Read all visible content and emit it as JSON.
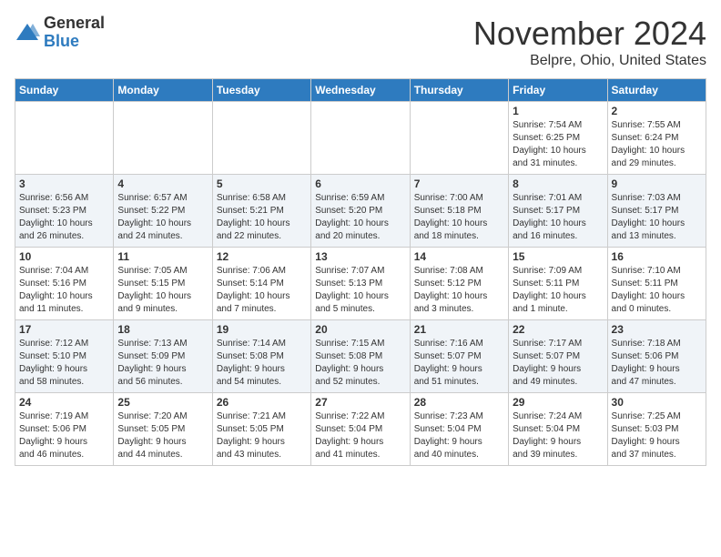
{
  "header": {
    "logo_general": "General",
    "logo_blue": "Blue",
    "month": "November 2024",
    "location": "Belpre, Ohio, United States"
  },
  "weekdays": [
    "Sunday",
    "Monday",
    "Tuesday",
    "Wednesday",
    "Thursday",
    "Friday",
    "Saturday"
  ],
  "weeks": [
    [
      {
        "day": "",
        "info": ""
      },
      {
        "day": "",
        "info": ""
      },
      {
        "day": "",
        "info": ""
      },
      {
        "day": "",
        "info": ""
      },
      {
        "day": "",
        "info": ""
      },
      {
        "day": "1",
        "info": "Sunrise: 7:54 AM\nSunset: 6:25 PM\nDaylight: 10 hours\nand 31 minutes."
      },
      {
        "day": "2",
        "info": "Sunrise: 7:55 AM\nSunset: 6:24 PM\nDaylight: 10 hours\nand 29 minutes."
      }
    ],
    [
      {
        "day": "3",
        "info": "Sunrise: 6:56 AM\nSunset: 5:23 PM\nDaylight: 10 hours\nand 26 minutes."
      },
      {
        "day": "4",
        "info": "Sunrise: 6:57 AM\nSunset: 5:22 PM\nDaylight: 10 hours\nand 24 minutes."
      },
      {
        "day": "5",
        "info": "Sunrise: 6:58 AM\nSunset: 5:21 PM\nDaylight: 10 hours\nand 22 minutes."
      },
      {
        "day": "6",
        "info": "Sunrise: 6:59 AM\nSunset: 5:20 PM\nDaylight: 10 hours\nand 20 minutes."
      },
      {
        "day": "7",
        "info": "Sunrise: 7:00 AM\nSunset: 5:18 PM\nDaylight: 10 hours\nand 18 minutes."
      },
      {
        "day": "8",
        "info": "Sunrise: 7:01 AM\nSunset: 5:17 PM\nDaylight: 10 hours\nand 16 minutes."
      },
      {
        "day": "9",
        "info": "Sunrise: 7:03 AM\nSunset: 5:17 PM\nDaylight: 10 hours\nand 13 minutes."
      }
    ],
    [
      {
        "day": "10",
        "info": "Sunrise: 7:04 AM\nSunset: 5:16 PM\nDaylight: 10 hours\nand 11 minutes."
      },
      {
        "day": "11",
        "info": "Sunrise: 7:05 AM\nSunset: 5:15 PM\nDaylight: 10 hours\nand 9 minutes."
      },
      {
        "day": "12",
        "info": "Sunrise: 7:06 AM\nSunset: 5:14 PM\nDaylight: 10 hours\nand 7 minutes."
      },
      {
        "day": "13",
        "info": "Sunrise: 7:07 AM\nSunset: 5:13 PM\nDaylight: 10 hours\nand 5 minutes."
      },
      {
        "day": "14",
        "info": "Sunrise: 7:08 AM\nSunset: 5:12 PM\nDaylight: 10 hours\nand 3 minutes."
      },
      {
        "day": "15",
        "info": "Sunrise: 7:09 AM\nSunset: 5:11 PM\nDaylight: 10 hours\nand 1 minute."
      },
      {
        "day": "16",
        "info": "Sunrise: 7:10 AM\nSunset: 5:11 PM\nDaylight: 10 hours\nand 0 minutes."
      }
    ],
    [
      {
        "day": "17",
        "info": "Sunrise: 7:12 AM\nSunset: 5:10 PM\nDaylight: 9 hours\nand 58 minutes."
      },
      {
        "day": "18",
        "info": "Sunrise: 7:13 AM\nSunset: 5:09 PM\nDaylight: 9 hours\nand 56 minutes."
      },
      {
        "day": "19",
        "info": "Sunrise: 7:14 AM\nSunset: 5:08 PM\nDaylight: 9 hours\nand 54 minutes."
      },
      {
        "day": "20",
        "info": "Sunrise: 7:15 AM\nSunset: 5:08 PM\nDaylight: 9 hours\nand 52 minutes."
      },
      {
        "day": "21",
        "info": "Sunrise: 7:16 AM\nSunset: 5:07 PM\nDaylight: 9 hours\nand 51 minutes."
      },
      {
        "day": "22",
        "info": "Sunrise: 7:17 AM\nSunset: 5:07 PM\nDaylight: 9 hours\nand 49 minutes."
      },
      {
        "day": "23",
        "info": "Sunrise: 7:18 AM\nSunset: 5:06 PM\nDaylight: 9 hours\nand 47 minutes."
      }
    ],
    [
      {
        "day": "24",
        "info": "Sunrise: 7:19 AM\nSunset: 5:06 PM\nDaylight: 9 hours\nand 46 minutes."
      },
      {
        "day": "25",
        "info": "Sunrise: 7:20 AM\nSunset: 5:05 PM\nDaylight: 9 hours\nand 44 minutes."
      },
      {
        "day": "26",
        "info": "Sunrise: 7:21 AM\nSunset: 5:05 PM\nDaylight: 9 hours\nand 43 minutes."
      },
      {
        "day": "27",
        "info": "Sunrise: 7:22 AM\nSunset: 5:04 PM\nDaylight: 9 hours\nand 41 minutes."
      },
      {
        "day": "28",
        "info": "Sunrise: 7:23 AM\nSunset: 5:04 PM\nDaylight: 9 hours\nand 40 minutes."
      },
      {
        "day": "29",
        "info": "Sunrise: 7:24 AM\nSunset: 5:04 PM\nDaylight: 9 hours\nand 39 minutes."
      },
      {
        "day": "30",
        "info": "Sunrise: 7:25 AM\nSunset: 5:03 PM\nDaylight: 9 hours\nand 37 minutes."
      }
    ]
  ]
}
